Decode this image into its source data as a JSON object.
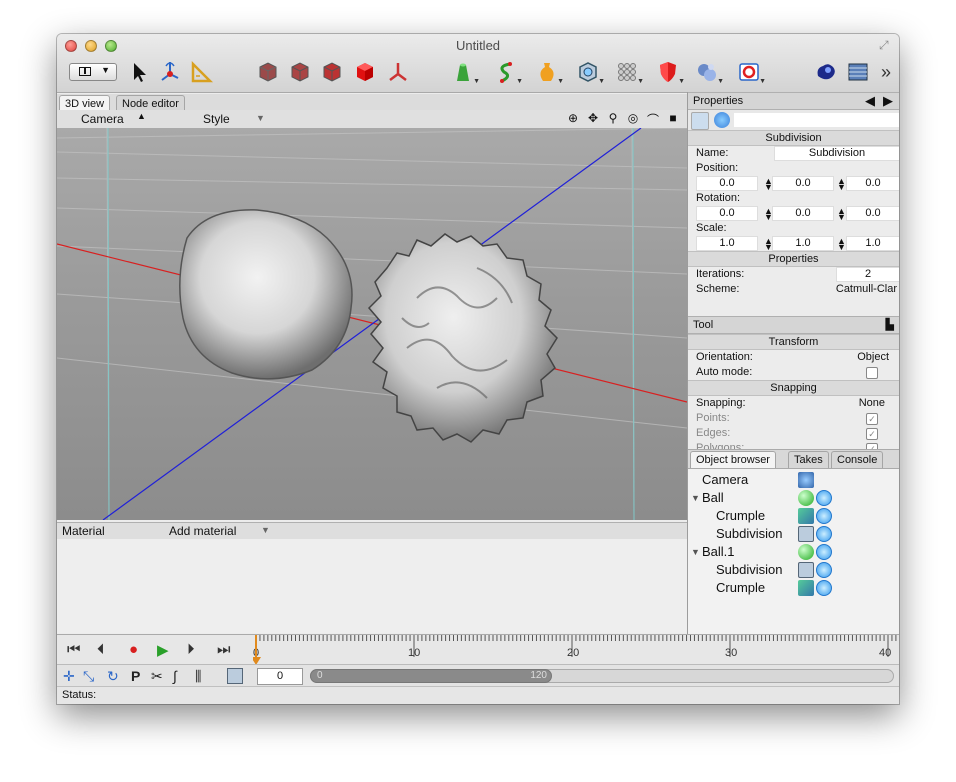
{
  "window": {
    "title": "Untitled"
  },
  "toolbar": {
    "icons": [
      "layout-icon",
      "pointer-icon",
      "move-tool-icon",
      "measure-tool-icon",
      "cube-wire-icon-1",
      "cube-wire-icon-2",
      "cube-wire-icon-3",
      "cube-solid-icon",
      "axis-tool-icon",
      "primitive-icon",
      "spline-icon",
      "vase-icon",
      "subdivision-icon",
      "array-icon",
      "shield-icon",
      "deformer-icon",
      "light-icon",
      "render-icon",
      "render-settings-icon"
    ],
    "overflow": "»"
  },
  "viewport": {
    "tabs": [
      "3D view",
      "Node editor"
    ],
    "camera_label": "Camera",
    "style_label": "Style",
    "nav_icons": [
      "target-icon",
      "pan-icon",
      "zoom-icon",
      "rotate-icon",
      "camera-icon",
      "record-icon"
    ]
  },
  "material": {
    "label": "Material",
    "add_label": "Add material"
  },
  "properties": {
    "title": "Properties",
    "object_type": "Subdivision",
    "name_label": "Name:",
    "name_value": "Subdivision",
    "position_label": "Position:",
    "position": [
      "0.0",
      "0.0",
      "0.0"
    ],
    "rotation_label": "Rotation:",
    "rotation": [
      "0.0",
      "0.0",
      "0.0"
    ],
    "scale_label": "Scale:",
    "scale": [
      "1.0",
      "1.0",
      "1.0"
    ],
    "section_properties": "Properties",
    "iterations_label": "Iterations:",
    "iterations_value": "2",
    "scheme_label": "Scheme:",
    "scheme_value": "Catmull-Clar"
  },
  "tool": {
    "title": "Tool",
    "section_transform": "Transform",
    "orientation_label": "Orientation:",
    "orientation_value": "Object",
    "automode_label": "Auto mode:",
    "section_snapping": "Snapping",
    "snapping_label": "Snapping:",
    "snapping_value": "None",
    "points_label": "Points:",
    "edges_label": "Edges:",
    "polygons_label": "Polygons:"
  },
  "browser": {
    "tabs": [
      "Object browser",
      "Takes",
      "Console"
    ],
    "items": [
      {
        "name": "Camera",
        "indent": 0
      },
      {
        "name": "Ball",
        "indent": 0
      },
      {
        "name": "Crumple",
        "indent": 1
      },
      {
        "name": "Subdivision",
        "indent": 1
      },
      {
        "name": "Ball.1",
        "indent": 0
      },
      {
        "name": "Subdivision",
        "indent": 1
      },
      {
        "name": "Crumple",
        "indent": 1
      }
    ]
  },
  "timeline": {
    "labels": [
      "0",
      "10",
      "20",
      "30",
      "40"
    ],
    "frame": "0",
    "range_start": "0",
    "range_end": "120"
  },
  "status": {
    "label": "Status:"
  },
  "colors": {
    "accent_blue": "#2a66c8",
    "axis_red": "#d82020",
    "axis_blue": "#2020d8",
    "playhead": "#e08a1e"
  }
}
